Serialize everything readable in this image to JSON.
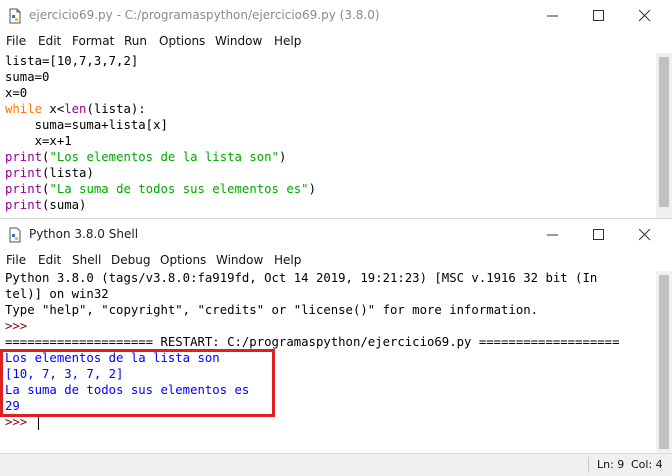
{
  "editor": {
    "title": "ejercicio69.py - C:/programaspython/ejercicio69.py (3.8.0)",
    "menu": [
      "File",
      "Edit",
      "Format",
      "Run",
      "Options",
      "Window",
      "Help"
    ],
    "code": [
      [
        {
          "t": "lista=[10,7,3,7,2]",
          "c": ""
        }
      ],
      [
        {
          "t": "suma=0",
          "c": ""
        }
      ],
      [
        {
          "t": "x=0",
          "c": ""
        }
      ],
      [
        {
          "t": "while",
          "c": "kw"
        },
        {
          "t": " x<",
          "c": ""
        },
        {
          "t": "len",
          "c": "bi"
        },
        {
          "t": "(lista):",
          "c": ""
        }
      ],
      [
        {
          "t": "    suma=suma+lista[x]",
          "c": ""
        }
      ],
      [
        {
          "t": "    x=x+1",
          "c": ""
        }
      ],
      [
        {
          "t": "print",
          "c": "bi"
        },
        {
          "t": "(",
          "c": ""
        },
        {
          "t": "\"Los elementos de la lista son\"",
          "c": "str"
        },
        {
          "t": ")",
          "c": ""
        }
      ],
      [
        {
          "t": "print",
          "c": "bi"
        },
        {
          "t": "(lista)",
          "c": ""
        }
      ],
      [
        {
          "t": "print",
          "c": "bi"
        },
        {
          "t": "(",
          "c": ""
        },
        {
          "t": "\"La suma de todos sus elementos es\"",
          "c": "str"
        },
        {
          "t": ")",
          "c": ""
        }
      ],
      [
        {
          "t": "print",
          "c": "bi"
        },
        {
          "t": "(suma)",
          "c": ""
        }
      ]
    ]
  },
  "shell": {
    "title": "Python 3.8.0 Shell",
    "menu": [
      "File",
      "Edit",
      "Shell",
      "Debug",
      "Options",
      "Window",
      "Help"
    ],
    "lines": [
      [
        {
          "t": "Python 3.8.0 (tags/v3.8.0:fa919fd, Oct 14 2019, 19:21:23) [MSC v.1916 32 bit (In",
          "c": ""
        }
      ],
      [
        {
          "t": "tel)] on win32",
          "c": ""
        }
      ],
      [
        {
          "t": "Type \"help\", \"copyright\", \"credits\" or \"license()\" for more information.",
          "c": ""
        }
      ],
      [
        {
          "t": ">>> ",
          "c": "prm"
        }
      ],
      [
        {
          "t": "==================== RESTART: C:/programaspython/ejercicio69.py ===================",
          "c": "restart"
        }
      ],
      [
        {
          "t": "Los elementos de la lista son",
          "c": "out"
        }
      ],
      [
        {
          "t": "[10, 7, 3, 7, 2]",
          "c": "out"
        }
      ],
      [
        {
          "t": "La suma de todos sus elementos es",
          "c": "out"
        }
      ],
      [
        {
          "t": "29",
          "c": "out"
        }
      ],
      [
        {
          "t": ">>> ",
          "c": "prm"
        }
      ]
    ]
  },
  "status": {
    "line": "Ln: 9",
    "col": "Col: 4"
  },
  "colors": {
    "keyword": "#ff7700",
    "builtin": "#900090",
    "string": "#00aa00",
    "output": "#0000ff",
    "highlight_box": "#e02020"
  }
}
